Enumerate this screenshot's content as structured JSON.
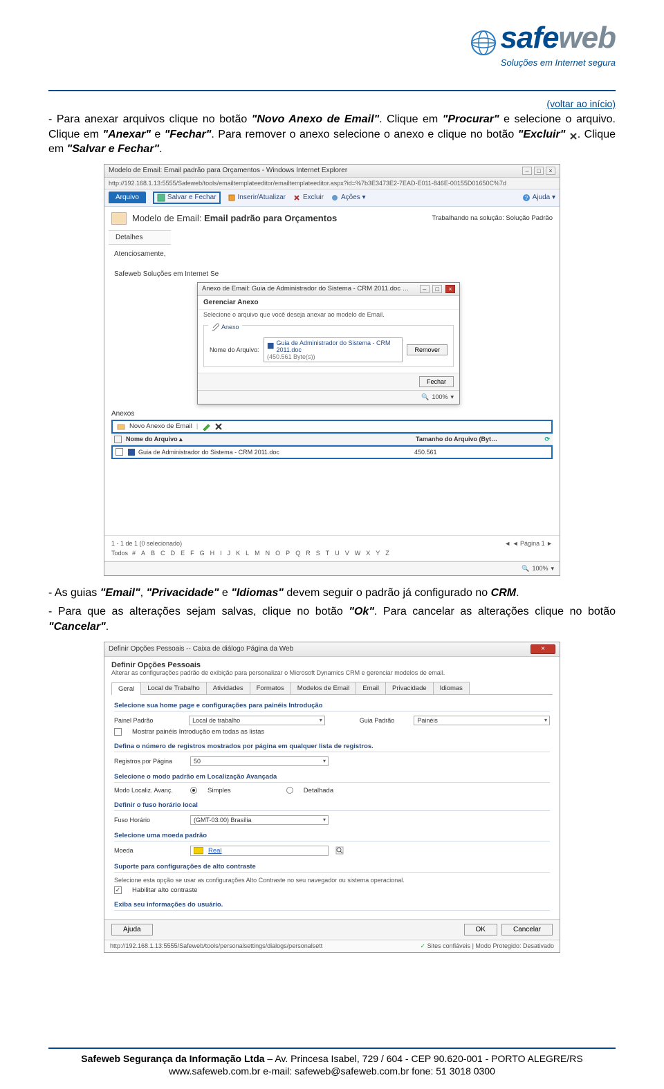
{
  "logo": {
    "brand_a": "safe",
    "brand_b": "web",
    "tagline": "Soluções em Internet segura"
  },
  "back_link": "(voltar ao início)",
  "para1": {
    "t1": "- Para anexar arquivos clique no botão ",
    "b1": "\"Novo Anexo de Email\"",
    "t2": ". Clique em ",
    "b2": "\"Procurar\"",
    "t3": " e selecione o arquivo. Clique em ",
    "b3": "\"Anexar\"",
    "t4": " e ",
    "b4": "\"Fechar\"",
    "t5": ". Para remover o anexo selecione o anexo e clique no botão ",
    "b5": "\"Excluir\"",
    "t6": ". Clique em ",
    "b6": "\"Salvar e Fechar\"",
    "t7": "."
  },
  "shot1": {
    "wintitle": "Modelo de Email: Email padrão para Orçamentos - Windows Internet Explorer",
    "url": "http://192.168.1.13:5555/Safeweb/tools/emailtemplateeditor/emailtemplateeditor.aspx?id=%7b3E3473E2-7EAD-E011-846E-00155D01650C%7d",
    "tab_arquivo": "Arquivo",
    "toolbar": {
      "salvar_fechar": "Salvar e Fechar",
      "inserir": "Inserir/Atualizar",
      "excluir": "Excluir",
      "acoes": "Ações ▾",
      "ajuda": "Ajuda ▾"
    },
    "header_prefix": "Modelo de Email: ",
    "header_title": "Email padrão para Orçamentos",
    "header_right": "Trabalhando na solução: Solução Padrão",
    "detalhes_tab": "Detalhes",
    "body_line1": "Atenciosamente,",
    "body_line2": "Safeweb Soluções em Internet Se",
    "dialog": {
      "title": "Anexo de Email: Guia de Administrador do Sistema - CRM 2011.doc …",
      "heading": "Gerenciar Anexo",
      "sub": "Selecione o arquivo que você deseja anexar ao modelo de Email.",
      "fieldset_legend": "Anexo",
      "label_nome": "Nome do Arquivo:",
      "file_name": "Guia de Administrador do Sistema - CRM 2011.doc",
      "file_size": "(450.561 Byte(s))",
      "btn_remover": "Remover",
      "btn_fechar": "Fechar",
      "zoom": "100%"
    },
    "anexos": {
      "heading": "Anexos",
      "novo": "Novo Anexo de Email",
      "col_nome": "Nome do Arquivo ▴",
      "col_tam": "Tamanho do Arquivo (Byt…",
      "row_name": "Guia de Administrador do Sistema - CRM 2011.doc",
      "row_size": "450.561"
    },
    "footer": {
      "count": "1 - 1 de 1 (0 selecionado)",
      "page": "◄  ◄ Página 1 ►",
      "todos": "Todos",
      "zoom": "100%"
    },
    "letters": [
      "#",
      "A",
      "B",
      "C",
      "D",
      "E",
      "F",
      "G",
      "H",
      "I",
      "J",
      "K",
      "L",
      "M",
      "N",
      "O",
      "P",
      "Q",
      "R",
      "S",
      "T",
      "U",
      "V",
      "W",
      "X",
      "Y",
      "Z"
    ]
  },
  "para2": {
    "t1": "- As guias ",
    "b1": "\"Email\"",
    "t2": ", ",
    "b2": "\"Privacidade\"",
    "t3": " e ",
    "b3": "\"Idiomas\"",
    "t4": " devem seguir o padrão já configurado no ",
    "b4": "CRM",
    "t5": "."
  },
  "para3": {
    "t1": "- Para que as alterações sejam salvas, clique no botão ",
    "b1": "\"Ok\"",
    "t2": ". Para cancelar as alterações clique no botão ",
    "b2": "\"Cancelar\"",
    "t3": "."
  },
  "shot2": {
    "wintitle": "Definir Opções Pessoais -- Caixa de diálogo Página da Web",
    "heading": "Definir Opções Pessoais",
    "sub": "Alterar as configurações padrão de exibição para personalizar o Microsoft Dynamics CRM e gerenciar modelos de email.",
    "tabs": [
      "Geral",
      "Local de Trabalho",
      "Atividades",
      "Formatos",
      "Modelos de Email",
      "Email",
      "Privacidade",
      "Idiomas"
    ],
    "sec1": {
      "h": "Selecione sua home page e configurações para painéis Introdução",
      "lbl_painel": "Painel Padrão",
      "val_painel": "Local de trabalho",
      "lbl_guia": "Guia Padrão",
      "val_guia": "Painéis",
      "chk": "Mostrar painéis Introdução em todas as listas"
    },
    "sec2": {
      "h": "Defina o número de registros mostrados por página em qualquer lista de registros.",
      "lbl": "Registros por Página",
      "val": "50"
    },
    "sec3": {
      "h": "Selecione o modo padrão em Localização Avançada",
      "lbl": "Modo Localiz. Avanç.",
      "opt1": "Simples",
      "opt2": "Detalhada"
    },
    "sec4": {
      "h": "Definir o fuso horário local",
      "lbl": "Fuso Horário",
      "val": "(GMT-03:00) Brasília"
    },
    "sec5": {
      "h": "Selecione uma moeda padrão",
      "lbl": "Moeda",
      "val": "Real"
    },
    "sec6": {
      "h": "Suporte para configurações de alto contraste",
      "sub": "Selecione esta opção se usar as configurações Alto Contraste no seu navegador ou sistema operacional.",
      "chk": "Habilitar alto contraste"
    },
    "sec7": "Exiba seu informações do usuário.",
    "buttons": {
      "ajuda": "Ajuda",
      "ok": "OK",
      "cancelar": "Cancelar"
    },
    "status_url": "http://192.168.1.13:5555/Safeweb/tools/personalsettings/dialogs/personalsett",
    "status_right": "Sites confiáveis | Modo Protegido: Desativado"
  },
  "footer": {
    "l1a": "Safeweb Segurança da Informação Ltda",
    "l1b": " – Av. Princesa Isabel, 729 / 604 - CEP 90.620-001 - PORTO ALEGRE/RS",
    "l2": "www.safeweb.com.br        e-mail: safeweb@safeweb.com.br        fone: 51 3018 0300"
  }
}
